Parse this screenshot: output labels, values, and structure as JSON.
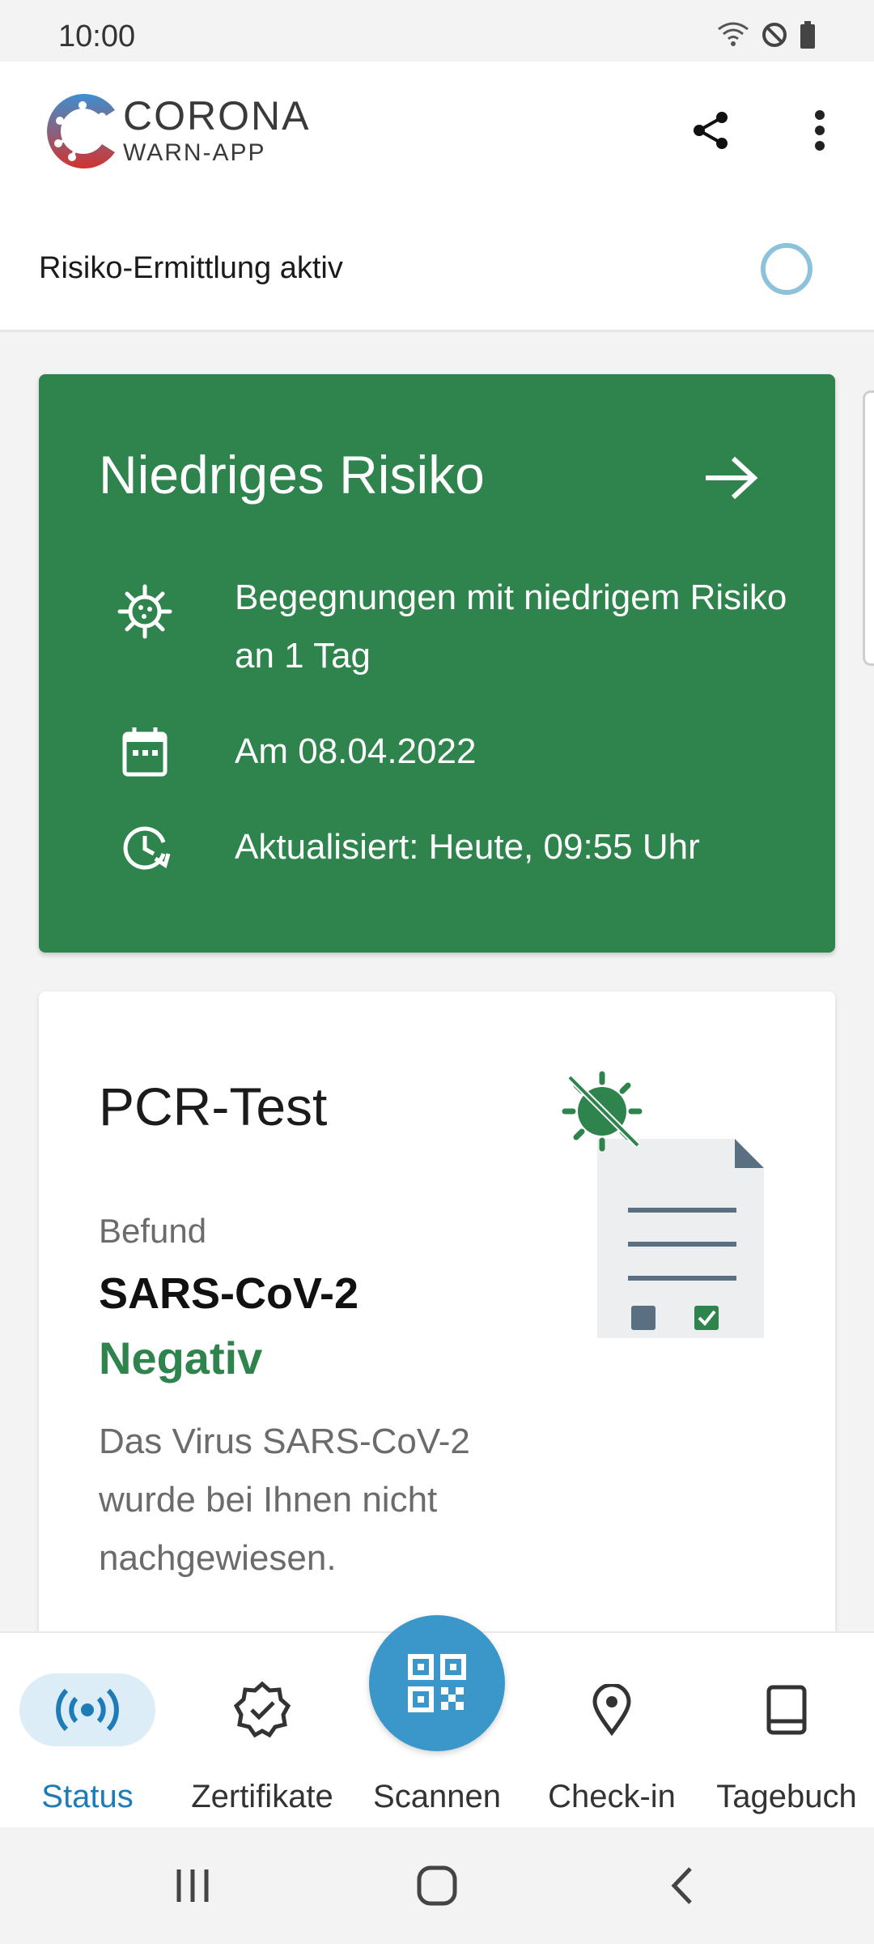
{
  "status_bar": {
    "time": "10:00"
  },
  "app": {
    "brand_line1": "CORONA",
    "brand_line2": "WARN-APP"
  },
  "risk_status": {
    "label": "Risiko-Ermittlung aktiv"
  },
  "risk_card": {
    "title": "Niedriges Risiko",
    "encounters": "Begegnungen mit niedrigem Risiko an 1 Tag",
    "date": "Am 08.04.2022",
    "updated": "Aktualisiert: Heute, 09:55 Uhr",
    "color": "#2e844c"
  },
  "pcr_card": {
    "title": "PCR-Test",
    "befund_label": "Befund",
    "virus": "SARS-CoV-2",
    "result": "Negativ",
    "description": "Das Virus SARS-CoV-2 wurde bei Ihnen nicht nachgewiesen."
  },
  "bottom_nav": {
    "items": [
      {
        "label": "Status",
        "icon": "broadcast-icon",
        "active": true
      },
      {
        "label": "Zertifikate",
        "icon": "certificate-badge-icon",
        "active": false
      },
      {
        "label": "Scannen",
        "icon": "qr-code-icon",
        "active": false
      },
      {
        "label": "Check-in",
        "icon": "location-pin-icon",
        "active": false
      },
      {
        "label": "Tagebuch",
        "icon": "book-icon",
        "active": false
      }
    ],
    "accent": "#1d7bb8"
  }
}
